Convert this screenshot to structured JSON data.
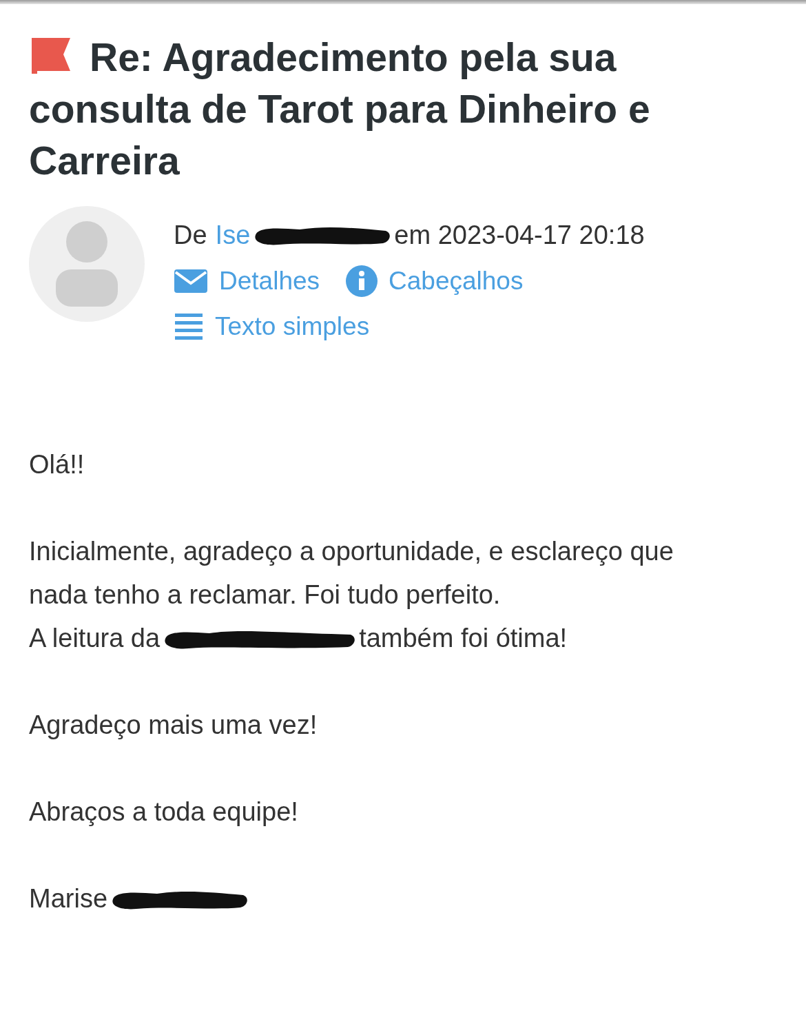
{
  "message": {
    "flagged": true,
    "subject": "Re: Agradecimento pela sua consulta de Tarot para Dinheiro e Carreira"
  },
  "sender": {
    "prefix": "De",
    "name": "Ise",
    "redacted": true,
    "date_text": "em 2023-04-17 20:18"
  },
  "actions": [
    {
      "kind": "details",
      "label": "Detalhes"
    },
    {
      "kind": "headers",
      "label": "Cabeçalhos"
    },
    {
      "kind": "plain",
      "label": "Texto simples"
    }
  ],
  "body": [
    {
      "lines": [
        {
          "before": "Olá!!",
          "redacted": false
        }
      ]
    },
    {
      "lines": [
        {
          "before": "Inicialmente, agradeço a oportunidade, e esclareço que",
          "redacted": false
        },
        {
          "before": "nada tenho a reclamar. Foi tudo perfeito.",
          "redacted": false
        },
        {
          "before": "A leitura da",
          "redacted": true,
          "after": "também foi ótima!"
        }
      ]
    },
    {
      "lines": [
        {
          "before": "Agradeço mais uma vez!",
          "redacted": false
        }
      ]
    },
    {
      "lines": [
        {
          "before": "Abraços a toda equipe!",
          "redacted": false
        }
      ]
    },
    {
      "lines": [
        {
          "before": "Marise",
          "redacted": true
        }
      ]
    }
  ]
}
